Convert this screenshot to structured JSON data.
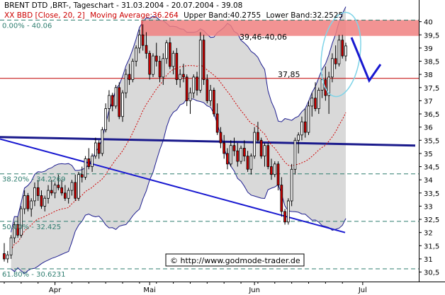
{
  "header": {
    "line1": "BRENT DTD ,BRT-, Tageschart - 31.03.2004 - 20.07.2004 - 39.08",
    "line2_prefix": "XX BBD [Close, 20, 2]",
    "line2_ma": "Moving Average:36.264",
    "line2_ub": "Upper Band:40.2755",
    "line2_lb": "Lower Band:32.2525"
  },
  "annotations": {
    "zone": "39,46-40,06",
    "level": "37,85",
    "copyright": "© http://www.godmode-trader.de"
  },
  "fib_labels": [
    {
      "text": "0.00% - 40.06",
      "value": 40.06
    },
    {
      "text": "38.20% - 34.2269",
      "value": 34.2269
    },
    {
      "text": "50.00% - 32.425",
      "value": 32.425
    },
    {
      "text": "61.80% - 30.6231",
      "value": 30.6231
    }
  ],
  "colors": {
    "up_candle": "#ffffff",
    "down_candle": "#d00000",
    "band_fill": "#d9d9d9",
    "band_line": "#1e1e90",
    "ma_line": "#d00000",
    "trendline": "#1818d0",
    "resistance_zone": "#f08080",
    "fib_line": "#2e7d6f",
    "level_line": "#c00000",
    "ellipse": "#7fd4e8",
    "arrow": "#1818d0"
  },
  "chart_data": {
    "type": "candlestick",
    "title": "BRENT DTD ,BRT-, Tageschart - 31.03.2004 - 20.07.2004 - 39.08",
    "ylim": [
      30.3,
      40.5
    ],
    "y_ticks": [
      30.5,
      31,
      31.5,
      32,
      32.5,
      33,
      33.5,
      34,
      34.5,
      35,
      35.5,
      36,
      36.5,
      37,
      37.5,
      38,
      38.5,
      39,
      39.5,
      40
    ],
    "y_tick_labels": [
      "30,5",
      "31",
      "31,5",
      "32",
      "32,5",
      "33",
      "33,5",
      "34",
      "34,5",
      "35",
      "35,5",
      "36",
      "36,5",
      "37",
      "37,5",
      "38",
      "38,5",
      "39",
      "39,5",
      "40"
    ],
    "x_labels": [
      {
        "label": "Apr",
        "index": 15
      },
      {
        "label": "Mai",
        "index": 43
      },
      {
        "label": "Jun",
        "index": 74
      },
      {
        "label": "Jul",
        "index": 106
      }
    ],
    "grid": false,
    "candles": [
      {
        "o": 31.2,
        "h": 31.6,
        "l": 30.9,
        "c": 31.0
      },
      {
        "o": 31.0,
        "h": 31.3,
        "l": 30.85,
        "c": 31.15
      },
      {
        "o": 31.15,
        "h": 31.9,
        "l": 31.0,
        "c": 31.8
      },
      {
        "o": 31.8,
        "h": 32.4,
        "l": 31.6,
        "c": 32.3
      },
      {
        "o": 32.3,
        "h": 32.6,
        "l": 31.8,
        "c": 31.9
      },
      {
        "o": 31.9,
        "h": 33.0,
        "l": 31.8,
        "c": 32.9
      },
      {
        "o": 32.9,
        "h": 33.6,
        "l": 32.7,
        "c": 33.4
      },
      {
        "o": 33.4,
        "h": 33.5,
        "l": 32.8,
        "c": 32.9
      },
      {
        "o": 32.9,
        "h": 33.3,
        "l": 32.6,
        "c": 33.2
      },
      {
        "o": 33.2,
        "h": 33.9,
        "l": 33.0,
        "c": 33.7
      },
      {
        "o": 33.7,
        "h": 34.0,
        "l": 33.2,
        "c": 33.4
      },
      {
        "o": 33.4,
        "h": 33.6,
        "l": 32.9,
        "c": 33.0
      },
      {
        "o": 33.0,
        "h": 33.4,
        "l": 32.8,
        "c": 33.3
      },
      {
        "o": 33.3,
        "h": 33.8,
        "l": 33.1,
        "c": 33.6
      },
      {
        "o": 33.6,
        "h": 34.0,
        "l": 33.4,
        "c": 33.5
      },
      {
        "o": 33.5,
        "h": 33.9,
        "l": 33.3,
        "c": 33.8
      },
      {
        "o": 33.8,
        "h": 34.2,
        "l": 33.6,
        "c": 33.7
      },
      {
        "o": 33.7,
        "h": 34.0,
        "l": 33.4,
        "c": 33.5
      },
      {
        "o": 33.5,
        "h": 33.8,
        "l": 33.2,
        "c": 33.3
      },
      {
        "o": 33.3,
        "h": 33.7,
        "l": 33.1,
        "c": 33.6
      },
      {
        "o": 33.6,
        "h": 34.0,
        "l": 33.4,
        "c": 33.9
      },
      {
        "o": 33.9,
        "h": 34.2,
        "l": 33.2,
        "c": 33.3
      },
      {
        "o": 33.3,
        "h": 34.3,
        "l": 33.2,
        "c": 34.2
      },
      {
        "o": 34.2,
        "h": 34.5,
        "l": 33.9,
        "c": 34.1
      },
      {
        "o": 34.1,
        "h": 34.9,
        "l": 34.0,
        "c": 34.8
      },
      {
        "o": 34.8,
        "h": 35.2,
        "l": 34.4,
        "c": 34.5
      },
      {
        "o": 34.5,
        "h": 35.0,
        "l": 34.3,
        "c": 34.9
      },
      {
        "o": 34.9,
        "h": 35.6,
        "l": 34.8,
        "c": 35.4
      },
      {
        "o": 35.4,
        "h": 35.5,
        "l": 34.8,
        "c": 35.0
      },
      {
        "o": 35.0,
        "h": 36.0,
        "l": 34.9,
        "c": 35.9
      },
      {
        "o": 35.9,
        "h": 36.9,
        "l": 35.8,
        "c": 36.7
      },
      {
        "o": 36.7,
        "h": 37.4,
        "l": 36.2,
        "c": 37.2
      },
      {
        "o": 37.2,
        "h": 37.3,
        "l": 36.6,
        "c": 36.8
      },
      {
        "o": 36.8,
        "h": 37.6,
        "l": 36.7,
        "c": 37.5
      },
      {
        "o": 37.5,
        "h": 37.7,
        "l": 36.3,
        "c": 36.4
      },
      {
        "o": 36.4,
        "h": 37.4,
        "l": 36.2,
        "c": 37.3
      },
      {
        "o": 37.3,
        "h": 38.2,
        "l": 37.1,
        "c": 38.0
      },
      {
        "o": 38.0,
        "h": 38.4,
        "l": 37.6,
        "c": 37.8
      },
      {
        "o": 37.8,
        "h": 38.6,
        "l": 37.7,
        "c": 38.5
      },
      {
        "o": 38.5,
        "h": 39.1,
        "l": 38.3,
        "c": 39.0
      },
      {
        "o": 39.0,
        "h": 39.7,
        "l": 38.8,
        "c": 39.5
      },
      {
        "o": 39.5,
        "h": 39.9,
        "l": 38.9,
        "c": 39.1
      },
      {
        "o": 39.1,
        "h": 39.6,
        "l": 38.6,
        "c": 38.8
      },
      {
        "o": 38.8,
        "h": 38.9,
        "l": 37.8,
        "c": 38.0
      },
      {
        "o": 38.0,
        "h": 38.8,
        "l": 37.9,
        "c": 38.7
      },
      {
        "o": 38.7,
        "h": 39.2,
        "l": 38.3,
        "c": 38.5
      },
      {
        "o": 38.5,
        "h": 38.7,
        "l": 37.7,
        "c": 37.9
      },
      {
        "o": 37.9,
        "h": 38.8,
        "l": 37.6,
        "c": 38.6
      },
      {
        "o": 38.6,
        "h": 39.3,
        "l": 38.4,
        "c": 39.2
      },
      {
        "o": 39.2,
        "h": 39.4,
        "l": 38.2,
        "c": 38.3
      },
      {
        "o": 38.3,
        "h": 38.9,
        "l": 38.0,
        "c": 38.8
      },
      {
        "o": 38.8,
        "h": 39.0,
        "l": 37.6,
        "c": 37.8
      },
      {
        "o": 37.8,
        "h": 38.2,
        "l": 37.5,
        "c": 38.0
      },
      {
        "o": 38.0,
        "h": 38.4,
        "l": 37.7,
        "c": 37.9
      },
      {
        "o": 37.9,
        "h": 38.0,
        "l": 36.8,
        "c": 37.0
      },
      {
        "o": 37.0,
        "h": 37.5,
        "l": 36.5,
        "c": 37.3
      },
      {
        "o": 37.3,
        "h": 38.0,
        "l": 37.1,
        "c": 37.9
      },
      {
        "o": 37.9,
        "h": 38.1,
        "l": 37.2,
        "c": 37.4
      },
      {
        "o": 37.4,
        "h": 39.6,
        "l": 37.3,
        "c": 39.3
      },
      {
        "o": 39.3,
        "h": 39.5,
        "l": 37.6,
        "c": 37.8
      },
      {
        "o": 37.8,
        "h": 38.0,
        "l": 36.9,
        "c": 37.0
      },
      {
        "o": 37.0,
        "h": 37.6,
        "l": 36.8,
        "c": 37.4
      },
      {
        "o": 37.4,
        "h": 37.5,
        "l": 36.4,
        "c": 36.5
      },
      {
        "o": 36.5,
        "h": 36.9,
        "l": 35.7,
        "c": 35.8
      },
      {
        "o": 35.8,
        "h": 36.0,
        "l": 35.2,
        "c": 35.4
      },
      {
        "o": 35.4,
        "h": 35.7,
        "l": 34.8,
        "c": 35.0
      },
      {
        "o": 35.0,
        "h": 35.2,
        "l": 34.4,
        "c": 34.6
      },
      {
        "o": 34.6,
        "h": 35.5,
        "l": 34.5,
        "c": 35.3
      },
      {
        "o": 35.3,
        "h": 35.6,
        "l": 34.9,
        "c": 35.1
      },
      {
        "o": 35.1,
        "h": 35.4,
        "l": 34.5,
        "c": 34.7
      },
      {
        "o": 34.7,
        "h": 35.3,
        "l": 34.6,
        "c": 35.2
      },
      {
        "o": 35.2,
        "h": 35.5,
        "l": 34.7,
        "c": 34.9
      },
      {
        "o": 34.9,
        "h": 35.1,
        "l": 34.3,
        "c": 34.4
      },
      {
        "o": 34.4,
        "h": 35.0,
        "l": 34.2,
        "c": 34.9
      },
      {
        "o": 34.9,
        "h": 36.0,
        "l": 34.8,
        "c": 35.8
      },
      {
        "o": 35.8,
        "h": 36.2,
        "l": 35.4,
        "c": 35.5
      },
      {
        "o": 35.5,
        "h": 35.6,
        "l": 34.8,
        "c": 34.9
      },
      {
        "o": 34.9,
        "h": 35.4,
        "l": 34.5,
        "c": 35.3
      },
      {
        "o": 35.3,
        "h": 35.4,
        "l": 34.4,
        "c": 34.5
      },
      {
        "o": 34.5,
        "h": 34.8,
        "l": 34.0,
        "c": 34.2
      },
      {
        "o": 34.2,
        "h": 34.7,
        "l": 34.1,
        "c": 34.6
      },
      {
        "o": 34.6,
        "h": 34.7,
        "l": 33.6,
        "c": 33.8
      },
      {
        "o": 33.8,
        "h": 34.1,
        "l": 32.6,
        "c": 32.8
      },
      {
        "o": 32.8,
        "h": 32.9,
        "l": 32.3,
        "c": 32.4
      },
      {
        "o": 32.4,
        "h": 33.3,
        "l": 32.3,
        "c": 33.2
      },
      {
        "o": 33.2,
        "h": 34.6,
        "l": 33.0,
        "c": 34.4
      },
      {
        "o": 34.4,
        "h": 35.6,
        "l": 34.2,
        "c": 35.5
      },
      {
        "o": 35.5,
        "h": 35.8,
        "l": 35.0,
        "c": 35.7
      },
      {
        "o": 35.7,
        "h": 36.4,
        "l": 35.5,
        "c": 36.2
      },
      {
        "o": 36.2,
        "h": 36.7,
        "l": 35.6,
        "c": 35.8
      },
      {
        "o": 35.8,
        "h": 37.0,
        "l": 35.7,
        "c": 36.8
      },
      {
        "o": 36.8,
        "h": 37.3,
        "l": 36.4,
        "c": 37.1
      },
      {
        "o": 37.1,
        "h": 37.7,
        "l": 36.6,
        "c": 36.7
      },
      {
        "o": 36.7,
        "h": 37.5,
        "l": 36.5,
        "c": 37.4
      },
      {
        "o": 37.4,
        "h": 38.0,
        "l": 37.1,
        "c": 37.8
      },
      {
        "o": 37.8,
        "h": 38.3,
        "l": 37.0,
        "c": 37.2
      },
      {
        "o": 37.2,
        "h": 38.1,
        "l": 36.5,
        "c": 37.9
      },
      {
        "o": 37.9,
        "h": 38.8,
        "l": 37.7,
        "c": 38.6
      },
      {
        "o": 38.6,
        "h": 39.1,
        "l": 38.2,
        "c": 38.4
      },
      {
        "o": 38.4,
        "h": 39.5,
        "l": 38.3,
        "c": 39.3
      },
      {
        "o": 39.3,
        "h": 39.5,
        "l": 38.6,
        "c": 38.7
      },
      {
        "o": 38.7,
        "h": 39.2,
        "l": 38.5,
        "c": 39.08
      }
    ],
    "bollinger": {
      "period": 20,
      "stddev": 2,
      "moving_average": 36.264,
      "upper_band": 40.2755,
      "lower_band": 32.2525
    },
    "horizontal_lines": [
      {
        "label": "0.00% - 40.06",
        "value": 40.06
      },
      {
        "label": "38.20% - 34.2269",
        "value": 34.2269
      },
      {
        "label": "50.00% - 32.425",
        "value": 32.425
      },
      {
        "label": "61.80% - 30.6231",
        "value": 30.6231
      },
      {
        "label": "37,85",
        "value": 37.85
      }
    ],
    "resistance_zone": {
      "label": "39,46-40,06",
      "from": 39.46,
      "to": 40.06
    }
  }
}
